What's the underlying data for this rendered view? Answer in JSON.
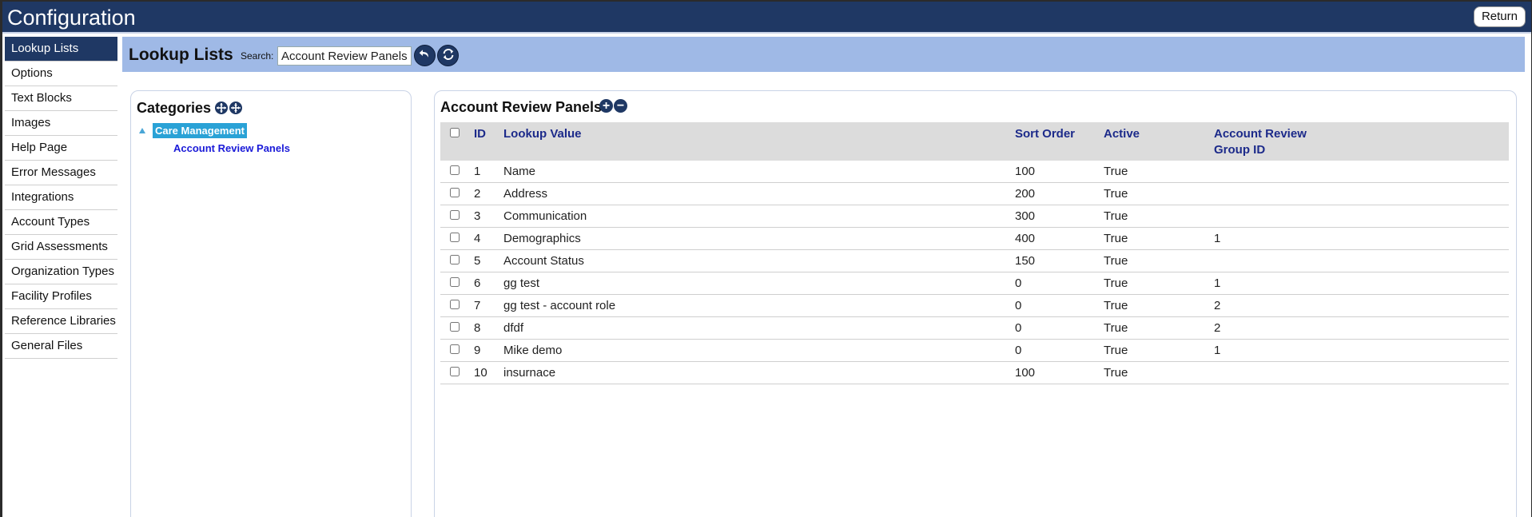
{
  "app": {
    "title": "Configuration",
    "return_label": "Return"
  },
  "sidebar": {
    "items": [
      {
        "label": "Lookup Lists",
        "active": true
      },
      {
        "label": "Options"
      },
      {
        "label": "Text Blocks"
      },
      {
        "label": "Images"
      },
      {
        "label": "Help Page"
      },
      {
        "label": "Error Messages"
      },
      {
        "label": "Integrations"
      },
      {
        "label": "Account Types"
      },
      {
        "label": "Grid Assessments"
      },
      {
        "label": "Organization Types"
      },
      {
        "label": "Facility Profiles"
      },
      {
        "label": "Reference Libraries"
      },
      {
        "label": "General Files"
      }
    ]
  },
  "toolbar": {
    "title": "Lookup Lists",
    "search_label": "Search:",
    "search_value": "Account Review Panels",
    "undo_icon": "undo-icon",
    "refresh_icon": "refresh-icon"
  },
  "categories": {
    "title": "Categories",
    "expand_icon": "expand-all-icon",
    "collapse_icon": "collapse-all-icon",
    "tree": {
      "parent": "Care Management",
      "child": "Account Review Panels"
    }
  },
  "grid": {
    "title": "Account Review Panels",
    "add_icon": "plus-icon",
    "remove_icon": "minus-icon",
    "columns": {
      "id": "ID",
      "value": "Lookup Value",
      "sort": "Sort Order",
      "active": "Active",
      "group": "Account Review Group ID"
    },
    "rows": [
      {
        "id": "1",
        "value": "Name",
        "sort": "100",
        "active": "True",
        "group": ""
      },
      {
        "id": "2",
        "value": "Address",
        "sort": "200",
        "active": "True",
        "group": ""
      },
      {
        "id": "3",
        "value": "Communication",
        "sort": "300",
        "active": "True",
        "group": ""
      },
      {
        "id": "4",
        "value": "Demographics",
        "sort": "400",
        "active": "True",
        "group": "1"
      },
      {
        "id": "5",
        "value": "Account Status",
        "sort": "150",
        "active": "True",
        "group": ""
      },
      {
        "id": "6",
        "value": "gg test",
        "sort": "0",
        "active": "True",
        "group": "1"
      },
      {
        "id": "7",
        "value": "gg test - account role",
        "sort": "0",
        "active": "True",
        "group": "2"
      },
      {
        "id": "8",
        "value": "dfdf",
        "sort": "0",
        "active": "True",
        "group": "2"
      },
      {
        "id": "9",
        "value": "Mike demo",
        "sort": "0",
        "active": "True",
        "group": "1"
      },
      {
        "id": "10",
        "value": "insurnace",
        "sort": "100",
        "active": "True",
        "group": ""
      }
    ]
  },
  "colors": {
    "header_bg": "#1f3864",
    "toolbar_bg": "#9fb9e6",
    "tree_selected_bg": "#2aa2d6",
    "column_header_text": "#1c2a8a",
    "link_text": "#1a1ad8"
  }
}
